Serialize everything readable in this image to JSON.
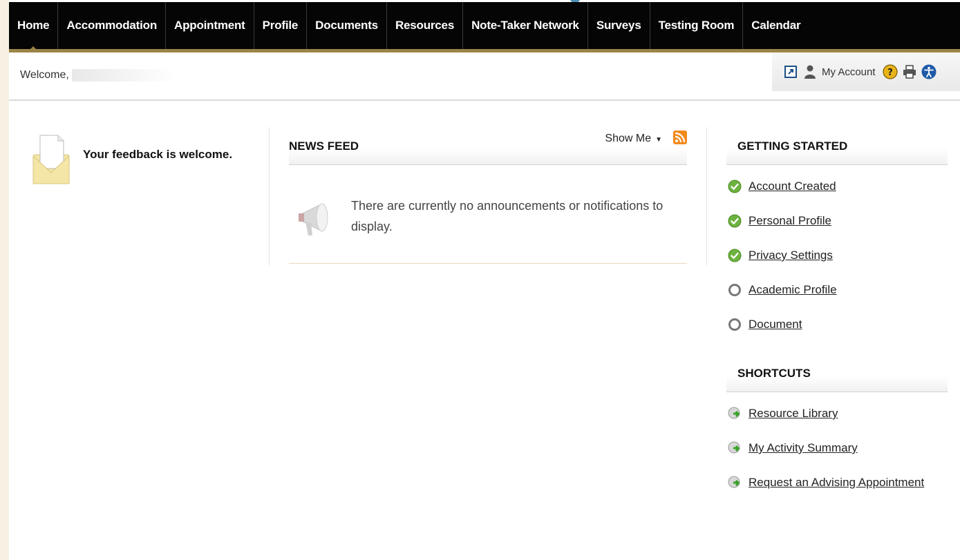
{
  "nav": {
    "items": [
      {
        "label": "Home"
      },
      {
        "label": "Accommodation"
      },
      {
        "label": "Appointment"
      },
      {
        "label": "Profile"
      },
      {
        "label": "Documents"
      },
      {
        "label": "Resources"
      },
      {
        "label": "Note-Taker Network"
      },
      {
        "label": "Surveys"
      },
      {
        "label": "Testing Room"
      },
      {
        "label": "Calendar"
      }
    ],
    "active_index": 0
  },
  "welcome": {
    "prefix": "Welcome,"
  },
  "toolbar": {
    "account_label": "My Account",
    "icons": [
      "external-link-icon",
      "user-icon",
      "help-icon",
      "print-icon",
      "accessibility-icon"
    ]
  },
  "feedback": {
    "text": "Your feedback is welcome."
  },
  "news_feed": {
    "title": "NEWS FEED",
    "show_me_label": "Show Me",
    "empty_message": "There are currently no announcements or notifications to display."
  },
  "getting_started": {
    "title": "GETTING STARTED",
    "steps": [
      {
        "label": "Account Created",
        "status": "complete"
      },
      {
        "label": "Personal Profile",
        "status": "complete"
      },
      {
        "label": "Privacy Settings",
        "status": "complete"
      },
      {
        "label": "Academic Profile",
        "status": "incomplete"
      },
      {
        "label": "Document",
        "status": "incomplete"
      }
    ]
  },
  "shortcuts": {
    "title": "SHORTCUTS",
    "items": [
      {
        "label": "Resource Library"
      },
      {
        "label": "My Activity Summary"
      },
      {
        "label": "Request an Advising Appointment"
      }
    ]
  },
  "colors": {
    "nav_bg": "#050505",
    "nav_accent": "#9b8447",
    "check_green": "#6db33f",
    "rss_orange": "#f28a1d"
  }
}
